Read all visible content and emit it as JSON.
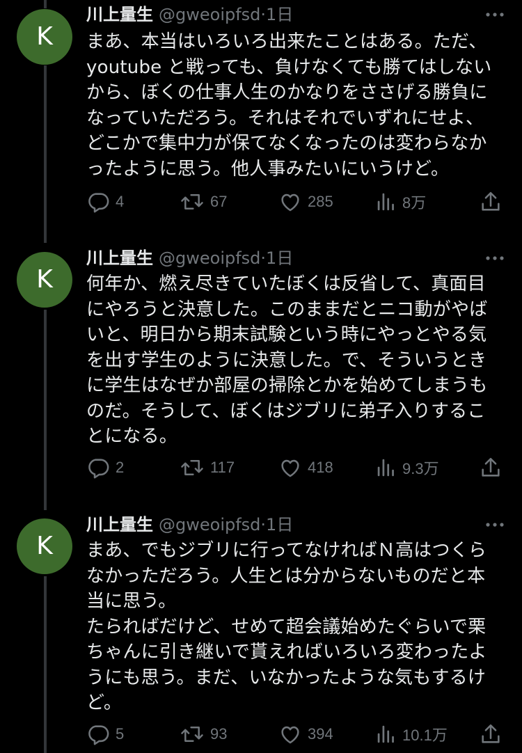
{
  "tweets": [
    {
      "avatar_letter": "K",
      "name": "川上量生",
      "handle": "@gweoipfsd",
      "separator": "·",
      "time": "1日",
      "text": "まあ、本当はいろいろ出来たことはある。ただ、\nyoutube と戦っても、負けなくても勝てはしない\nから、ぼくの仕事人生のかなりをささげる勝負に\nなっていただろう。それはそれでいずれにせよ、\nどこかで集中力が保てなくなったのは変わらなか\nったように思う。他人事みたいにいうけど。",
      "replies": "4",
      "retweets": "67",
      "likes": "285",
      "views": "8万"
    },
    {
      "avatar_letter": "K",
      "name": "川上量生",
      "handle": "@gweoipfsd",
      "separator": "·",
      "time": "1日",
      "text": "何年か、燃え尽きていたぼくは反省して、真面目\nにやろうと決意した。このままだとニコ動がやば\nいと、明日から期末試験という時にやっとやる気\nを出す学生のように決意した。で、そういうとき\nに学生はなぜか部屋の掃除とかを始めてしまうも\nのだ。そうして、ぼくはジブリに弟子入りするこ\nとになる。",
      "replies": "2",
      "retweets": "117",
      "likes": "418",
      "views": "9.3万"
    },
    {
      "avatar_letter": "K",
      "name": "川上量生",
      "handle": "@gweoipfsd",
      "separator": "·",
      "time": "1日",
      "text": "まあ、でもジブリに行ってなければＮ高はつくら\nなかっただろう。人生とは分からないものだと本\n当に思う。\nたらればだけど、せめて超会議始めたぐらいで栗\nちゃんに引き継いで貰えればいろいろ変わったよ\nうにも思う。まだ、いなかったような気もするけ\nど。",
      "replies": "5",
      "retweets": "93",
      "likes": "394",
      "views": "10.1万"
    }
  ],
  "colors": {
    "background": "#000000",
    "text": "#e7e9ea",
    "secondary": "#71767b",
    "avatar": "#3d6b2c",
    "thread_line": "#333639"
  },
  "icons": [
    "reply-icon",
    "retweet-icon",
    "like-icon",
    "views-icon",
    "share-icon",
    "more-icon"
  ]
}
